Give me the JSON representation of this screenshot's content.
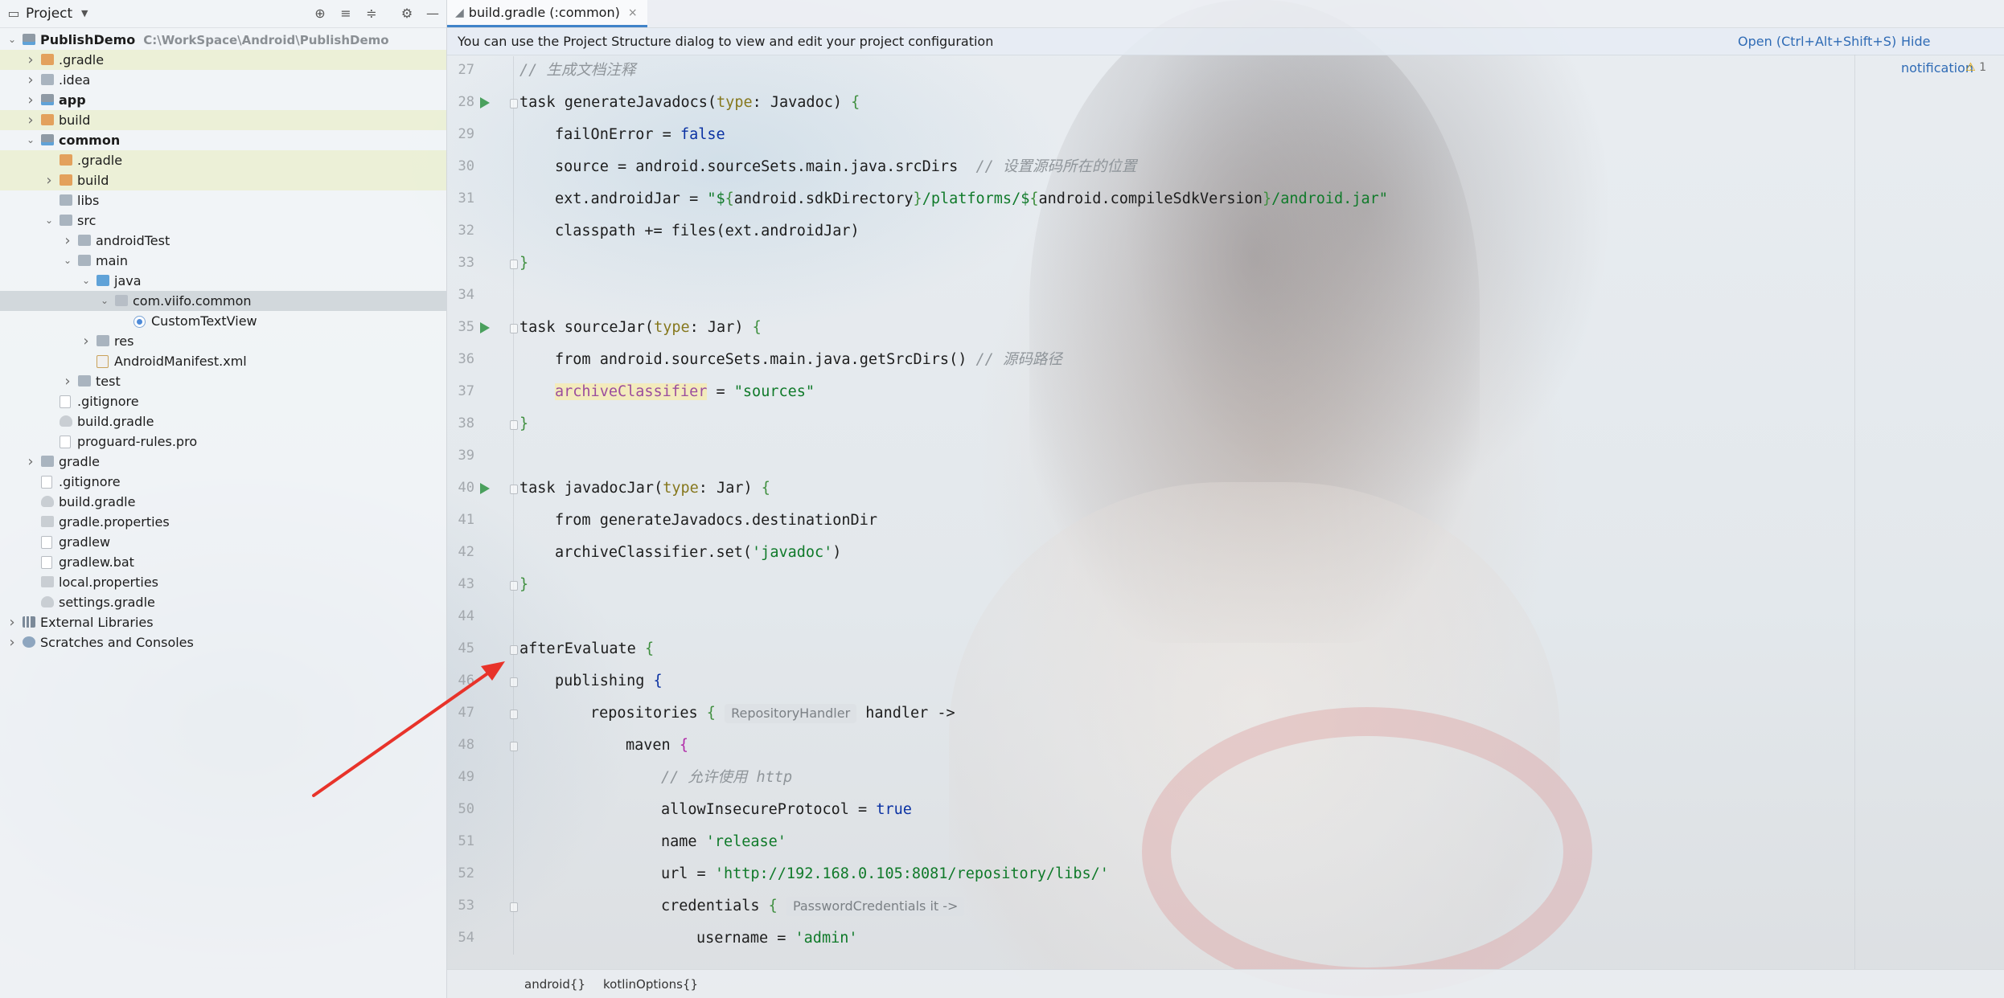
{
  "project": {
    "title": "Project",
    "tree": [
      {
        "label": "PublishDemo",
        "path": "C:\\WorkSpace\\Android\\PublishDemo",
        "bold": true,
        "arrow": "down",
        "icon": "folder-module",
        "depth": 0
      },
      {
        "label": ".gradle",
        "arrow": "right",
        "icon": "folder-orange",
        "depth": 1,
        "hl": true
      },
      {
        "label": ".idea",
        "arrow": "right",
        "icon": "folder",
        "depth": 1
      },
      {
        "label": "app",
        "arrow": "right",
        "icon": "folder-module",
        "depth": 1,
        "bold": true
      },
      {
        "label": "build",
        "arrow": "right",
        "icon": "folder-orange",
        "depth": 1,
        "hl": true
      },
      {
        "label": "common",
        "arrow": "down",
        "icon": "folder-module",
        "depth": 1,
        "bold": true
      },
      {
        "label": ".gradle",
        "arrow": "",
        "icon": "folder-orange",
        "depth": 2,
        "hl": true
      },
      {
        "label": "build",
        "arrow": "right",
        "icon": "folder-orange",
        "depth": 2,
        "hl": true
      },
      {
        "label": "libs",
        "arrow": "",
        "icon": "folder",
        "depth": 2
      },
      {
        "label": "src",
        "arrow": "down",
        "icon": "folder",
        "depth": 2
      },
      {
        "label": "androidTest",
        "arrow": "right",
        "icon": "folder",
        "depth": 3
      },
      {
        "label": "main",
        "arrow": "down",
        "icon": "folder",
        "depth": 3
      },
      {
        "label": "java",
        "arrow": "down",
        "icon": "folder-blue",
        "depth": 4
      },
      {
        "label": "com.viifo.common",
        "arrow": "down",
        "icon": "package",
        "depth": 5,
        "selected": true
      },
      {
        "label": "CustomTextView",
        "arrow": "",
        "icon": "kt",
        "depth": 6
      },
      {
        "label": "res",
        "arrow": "right",
        "icon": "folder",
        "depth": 4
      },
      {
        "label": "AndroidManifest.xml",
        "arrow": "",
        "icon": "xml",
        "depth": 4
      },
      {
        "label": "test",
        "arrow": "right",
        "icon": "folder",
        "depth": 3
      },
      {
        "label": ".gitignore",
        "arrow": "",
        "icon": "file",
        "depth": 2
      },
      {
        "label": "build.gradle",
        "arrow": "",
        "icon": "gradle",
        "depth": 2
      },
      {
        "label": "proguard-rules.pro",
        "arrow": "",
        "icon": "file",
        "depth": 2
      },
      {
        "label": "gradle",
        "arrow": "right",
        "icon": "folder",
        "depth": 1
      },
      {
        "label": ".gitignore",
        "arrow": "",
        "icon": "file",
        "depth": 1
      },
      {
        "label": "build.gradle",
        "arrow": "",
        "icon": "gradle",
        "depth": 1
      },
      {
        "label": "gradle.properties",
        "arrow": "",
        "icon": "props",
        "depth": 1
      },
      {
        "label": "gradlew",
        "arrow": "",
        "icon": "file",
        "depth": 1
      },
      {
        "label": "gradlew.bat",
        "arrow": "",
        "icon": "file",
        "depth": 1
      },
      {
        "label": "local.properties",
        "arrow": "",
        "icon": "props",
        "depth": 1
      },
      {
        "label": "settings.gradle",
        "arrow": "",
        "icon": "gradle",
        "depth": 1
      },
      {
        "label": "External Libraries",
        "arrow": "right",
        "icon": "lib",
        "depth": 0
      },
      {
        "label": "Scratches and Consoles",
        "arrow": "right",
        "icon": "scratch",
        "depth": 0
      }
    ]
  },
  "editor": {
    "tab_label": "build.gradle (:common)",
    "notification": {
      "message": "You can use the Project Structure dialog to view and edit your project configuration",
      "open_link": "Open (Ctrl+Alt+Shift+S)",
      "hide_link": "Hide notification"
    },
    "warning_count": "1",
    "lines": [
      {
        "n": "27",
        "indent": 0,
        "html": "<span class=\"c\">// 生成文档注释</span>"
      },
      {
        "n": "28",
        "indent": 0,
        "run": true,
        "fold": true,
        "html": "task generateJavadocs(<span class=\"t\">type</span>: Javadoc) <span class=\"bracket-y\">{</span>"
      },
      {
        "n": "29",
        "indent": 1,
        "html": "failOnError = <span class=\"k\">false</span>"
      },
      {
        "n": "30",
        "indent": 1,
        "html": "source = android.sourceSets.main.java.srcDirs  <span class=\"c\">// 设置源码所在的位置</span>"
      },
      {
        "n": "31",
        "indent": 1,
        "html": "ext.androidJar = <span class=\"s\">\"$<span class=\"bracket-y\">{</span><span class=\"interp\">android.sdkDirectory</span><span class=\"bracket-y\">}</span>/platforms/$<span class=\"bracket-y\">{</span><span class=\"interp\">android.compileSdkVersion</span><span class=\"bracket-y\">}</span>/android.jar\"</span>"
      },
      {
        "n": "32",
        "indent": 1,
        "html": "classpath += files(ext.androidJar)"
      },
      {
        "n": "33",
        "indent": 0,
        "fold": true,
        "html": "<span class=\"bracket-y\">}</span>"
      },
      {
        "n": "34",
        "indent": 0,
        "html": ""
      },
      {
        "n": "35",
        "indent": 0,
        "run": true,
        "fold": true,
        "html": "task sourceJar(<span class=\"t\">type</span>: Jar) <span class=\"bracket-y\">{</span>"
      },
      {
        "n": "36",
        "indent": 1,
        "html": "from android.sourceSets.main.java.getSrcDirs() <span class=\"c\">// 源码路径</span>"
      },
      {
        "n": "37",
        "indent": 1,
        "html": "<span class=\"tagged\">archiveClassifier</span> = <span class=\"s\">\"sources\"</span>"
      },
      {
        "n": "38",
        "indent": 0,
        "fold": true,
        "html": "<span class=\"bracket-y\">}</span>"
      },
      {
        "n": "39",
        "indent": 0,
        "html": ""
      },
      {
        "n": "40",
        "indent": 0,
        "run": true,
        "fold": true,
        "html": "task javadocJar(<span class=\"t\">type</span>: Jar) <span class=\"bracket-y\">{</span>"
      },
      {
        "n": "41",
        "indent": 1,
        "html": "from generateJavadocs.destinationDir"
      },
      {
        "n": "42",
        "indent": 1,
        "html": "archiveClassifier.set(<span class=\"s\">'javadoc'</span>)"
      },
      {
        "n": "43",
        "indent": 0,
        "fold": true,
        "html": "<span class=\"bracket-y\">}</span>"
      },
      {
        "n": "44",
        "indent": 0,
        "html": ""
      },
      {
        "n": "45",
        "indent": 0,
        "fold": true,
        "html": "afterEvaluate <span class=\"bracket-y\">{</span>"
      },
      {
        "n": "46",
        "indent": 1,
        "fold": true,
        "html": "publishing <span class=\"k\">{</span>"
      },
      {
        "n": "47",
        "indent": 2,
        "fold": true,
        "html": "repositories <span class=\"bracket-y\">{</span> <span class=\"hint\">RepositoryHandler</span> handler ->"
      },
      {
        "n": "48",
        "indent": 3,
        "fold": true,
        "html": "maven <span class=\"bracket-p\">{</span>"
      },
      {
        "n": "49",
        "indent": 4,
        "html": "<span class=\"c\">// 允许使用 http</span>"
      },
      {
        "n": "50",
        "indent": 4,
        "html": "allowInsecureProtocol = <span class=\"k\">true</span>"
      },
      {
        "n": "51",
        "indent": 4,
        "html": "name <span class=\"s\">'release'</span>"
      },
      {
        "n": "52",
        "indent": 4,
        "html": "url = <span class=\"s\">'http://192.168.0.105:8081/repository/libs/'</span>"
      },
      {
        "n": "53",
        "indent": 4,
        "fold": true,
        "html": "credentials <span class=\"bracket-y\">{</span> <span class=\"hint\">PasswordCredentials it -></span>"
      },
      {
        "n": "54",
        "indent": 5,
        "html": "username = <span class=\"s\">'admin'</span>"
      }
    ],
    "breadcrumbs": [
      "android{}",
      "kotlinOptions{}"
    ]
  },
  "colors": {
    "accent": "#4083c9",
    "run_gutter": "#4aa05d",
    "annotation_arrow": "#e8332a"
  }
}
